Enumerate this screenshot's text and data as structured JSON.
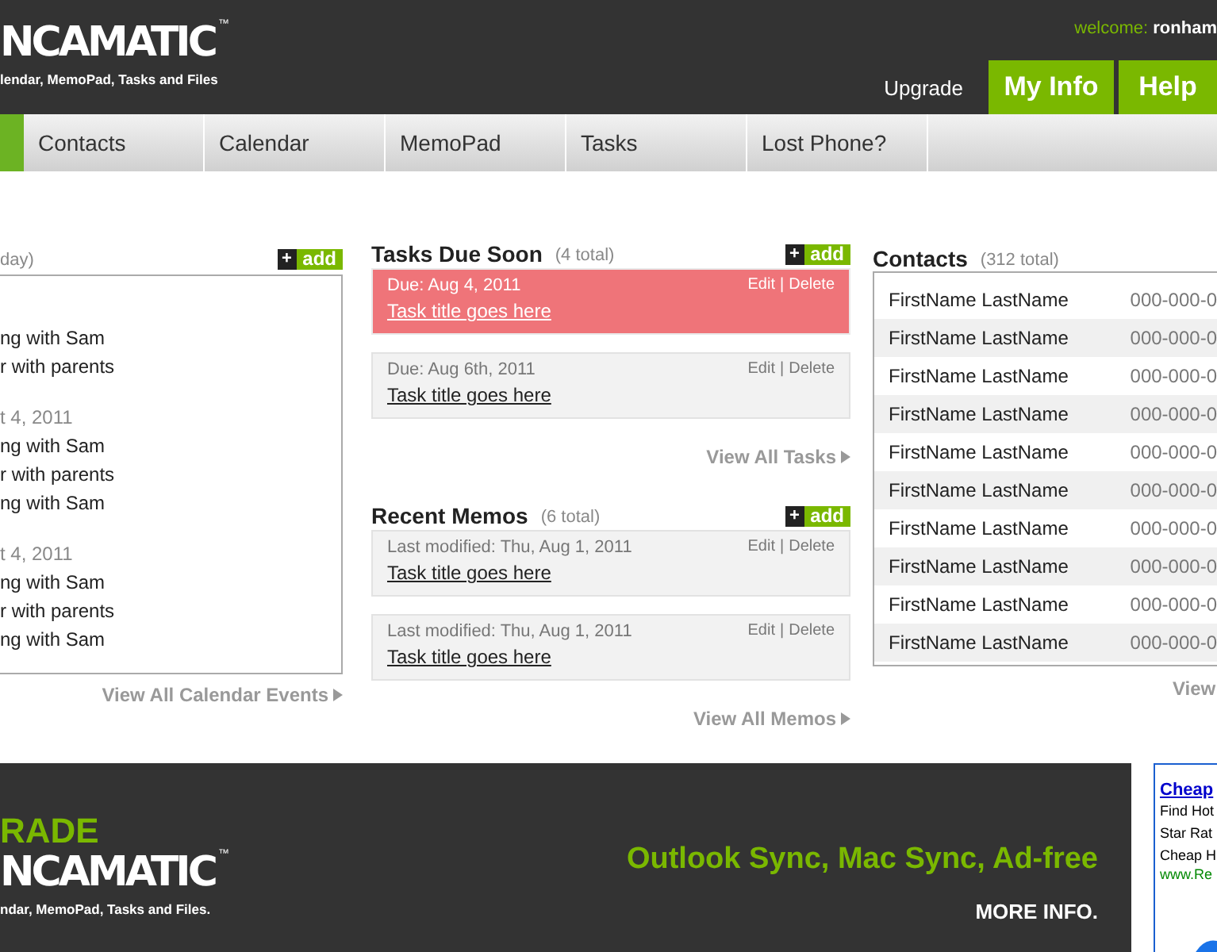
{
  "header": {
    "logo": "NCAMATIC",
    "logo_mark": "™",
    "tagline": "lendar, MemoPad, Tasks and Files",
    "welcome_label": "welcome:",
    "username": "ronham",
    "links": [
      {
        "label": "Upgrade",
        "kind": "plain"
      },
      {
        "label": "My Info",
        "kind": "tab"
      },
      {
        "label": "Help",
        "kind": "tab"
      }
    ]
  },
  "nav": [
    {
      "label": "Contacts",
      "selected": false
    },
    {
      "label": "Calendar",
      "selected": false
    },
    {
      "label": "MemoPad",
      "selected": false
    },
    {
      "label": "Tasks",
      "selected": false
    },
    {
      "label": "Lost Phone?",
      "selected": false
    }
  ],
  "calendar": {
    "count": "day)",
    "add": {
      "plus": "+",
      "label": "add"
    },
    "groups": [
      {
        "events": [
          "ng with Sam",
          "r with parents"
        ]
      },
      {
        "date": "t 4, 2011",
        "events": [
          "ng with Sam",
          "r with parents",
          "ng with Sam"
        ]
      },
      {
        "date": "t 4, 2011",
        "events": [
          "ng with Sam",
          "r with parents",
          "ng with Sam"
        ]
      }
    ],
    "view_all": "View All Calendar Events"
  },
  "tasks": {
    "title": "Tasks Due Soon",
    "count": "(4 total)",
    "add": {
      "plus": "+",
      "label": "add"
    },
    "items": [
      {
        "meta": "Due: Aug 4, 2011",
        "title": "Task title goes here",
        "overdue": true,
        "edit": "Edit",
        "sep": "|",
        "delete": "Delete"
      },
      {
        "meta": "Due: Aug 6th, 2011",
        "title": "Task title goes here",
        "overdue": false,
        "edit": "Edit",
        "sep": "|",
        "delete": "Delete"
      }
    ],
    "view_all": "View All Tasks"
  },
  "memos": {
    "title": "Recent Memos",
    "count": "(6 total)",
    "add": {
      "plus": "+",
      "label": "add"
    },
    "items": [
      {
        "meta": "Last modified: Thu, Aug 1, 2011",
        "title": "Task title goes here",
        "overdue": false,
        "edit": "Edit",
        "sep": "|",
        "delete": "Delete"
      },
      {
        "meta": "Last modified: Thu, Aug 1, 2011",
        "title": "Task title goes here",
        "overdue": false,
        "edit": "Edit",
        "sep": "|",
        "delete": "Delete"
      }
    ],
    "view_all": "View All Memos"
  },
  "contacts": {
    "title": "Contacts",
    "count": "(312 total)",
    "rows": [
      {
        "name": "FirstName LastName",
        "phone": "000-000-0"
      },
      {
        "name": "FirstName LastName",
        "phone": "000-000-0"
      },
      {
        "name": "FirstName LastName",
        "phone": "000-000-0"
      },
      {
        "name": "FirstName LastName",
        "phone": "000-000-0"
      },
      {
        "name": "FirstName LastName",
        "phone": "000-000-0"
      },
      {
        "name": "FirstName LastName",
        "phone": "000-000-0"
      },
      {
        "name": "FirstName LastName",
        "phone": "000-000-0"
      },
      {
        "name": "FirstName LastName",
        "phone": "000-000-0"
      },
      {
        "name": "FirstName LastName",
        "phone": "000-000-0"
      },
      {
        "name": "FirstName LastName",
        "phone": "000-000-0"
      }
    ],
    "view_all": "View"
  },
  "promo": {
    "kicker": "RADE",
    "logo": "NCAMATIC",
    "logo_mark": "™",
    "tagline": "ndar, MemoPad, Tasks and Files.",
    "headline": "Outlook Sync, Mac Sync, Ad-free",
    "more": "MORE INFO."
  },
  "ad": {
    "link": "Cheap",
    "lines": [
      "Find Hot",
      "Star Rat",
      "Cheap H"
    ],
    "url": "www.Re"
  }
}
